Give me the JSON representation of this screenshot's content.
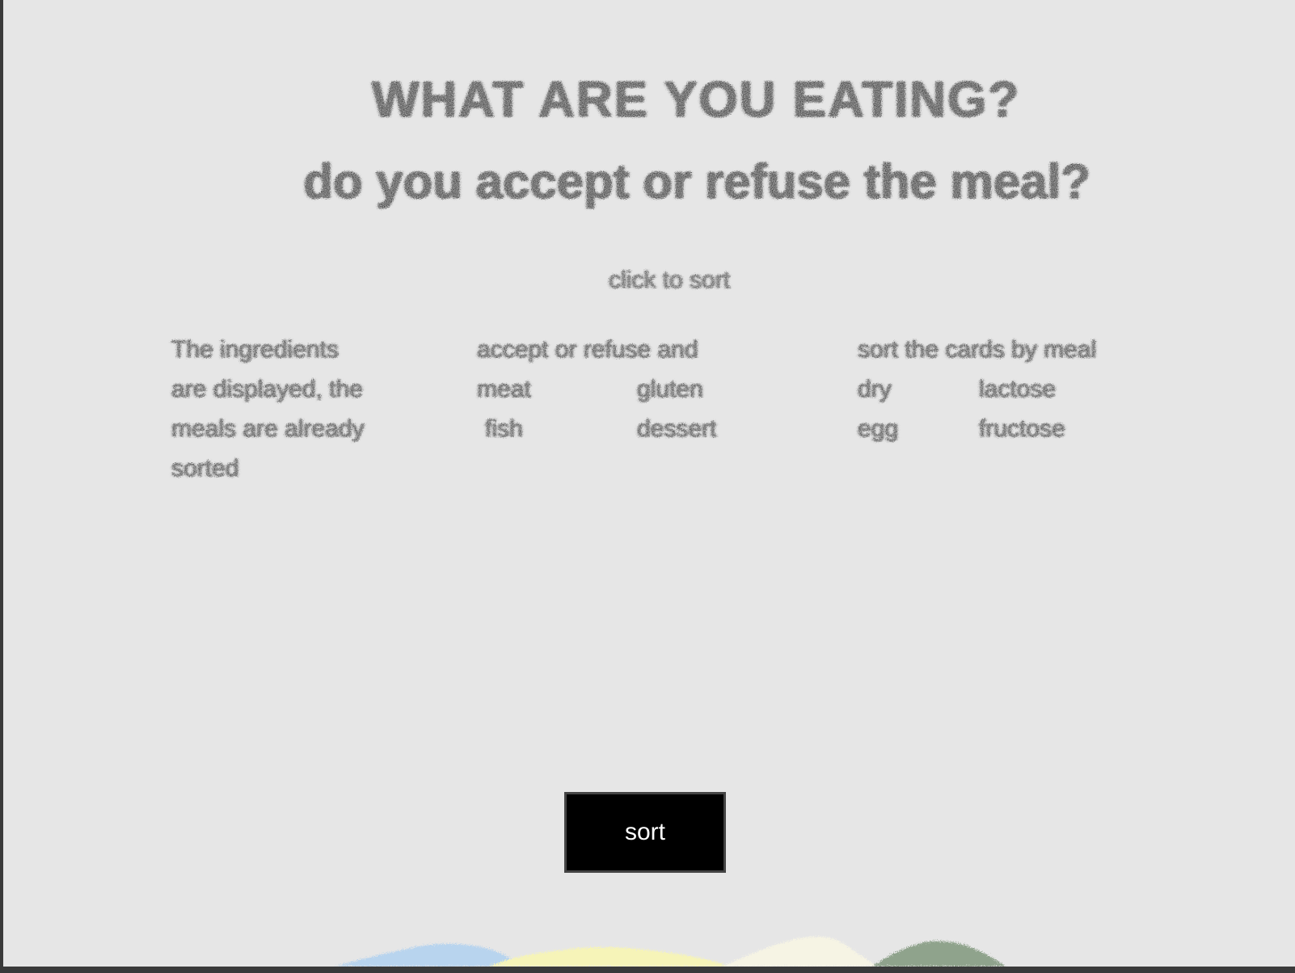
{
  "page": {
    "heading_line1": "What are you eating?",
    "heading_line2": "do you accept or refuse the meal?",
    "subheading": "click to sort"
  },
  "columns": [
    {
      "lines": [
        [
          "The ingredients"
        ],
        [
          "are displayed, the"
        ],
        [
          "meals are already"
        ],
        [
          "sorted"
        ]
      ]
    },
    {
      "lines": [
        [
          "accept or refuse and"
        ],
        [
          "meat",
          "gluten"
        ],
        [
          "fish",
          "dessert"
        ]
      ]
    },
    {
      "lines": [
        [
          "sort the cards by meal"
        ],
        [
          "dry",
          "lactose"
        ],
        [
          "egg",
          "fructose"
        ]
      ]
    }
  ],
  "actions": {
    "sort_label": "sort"
  },
  "colors": {
    "background": "#e6e6e6",
    "button_bg": "#000000",
    "button_text": "#ffffff",
    "hill_blue": "#b8d4ee",
    "hill_yellow": "#f6f4b8",
    "hill_cream": "#f6f4e4",
    "hill_green": "#8fa38c"
  }
}
